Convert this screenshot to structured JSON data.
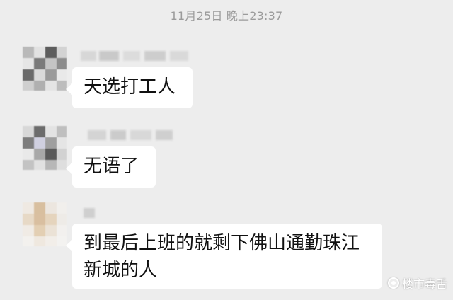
{
  "chat": {
    "timestamp": "11月25日 晚上23:37",
    "messages": [
      {
        "text": "天选打工人"
      },
      {
        "text": "无语了"
      },
      {
        "text": "到最后上班的就剩下佛山通勤珠江新城的人"
      }
    ]
  },
  "watermark": {
    "text": "楼市毒舌",
    "icon": "weibo-style-logo-icon"
  },
  "colors": {
    "background": "#ededed",
    "bubble": "#ffffff",
    "timestamp": "#9b9b9b",
    "message_text": "#111111"
  }
}
